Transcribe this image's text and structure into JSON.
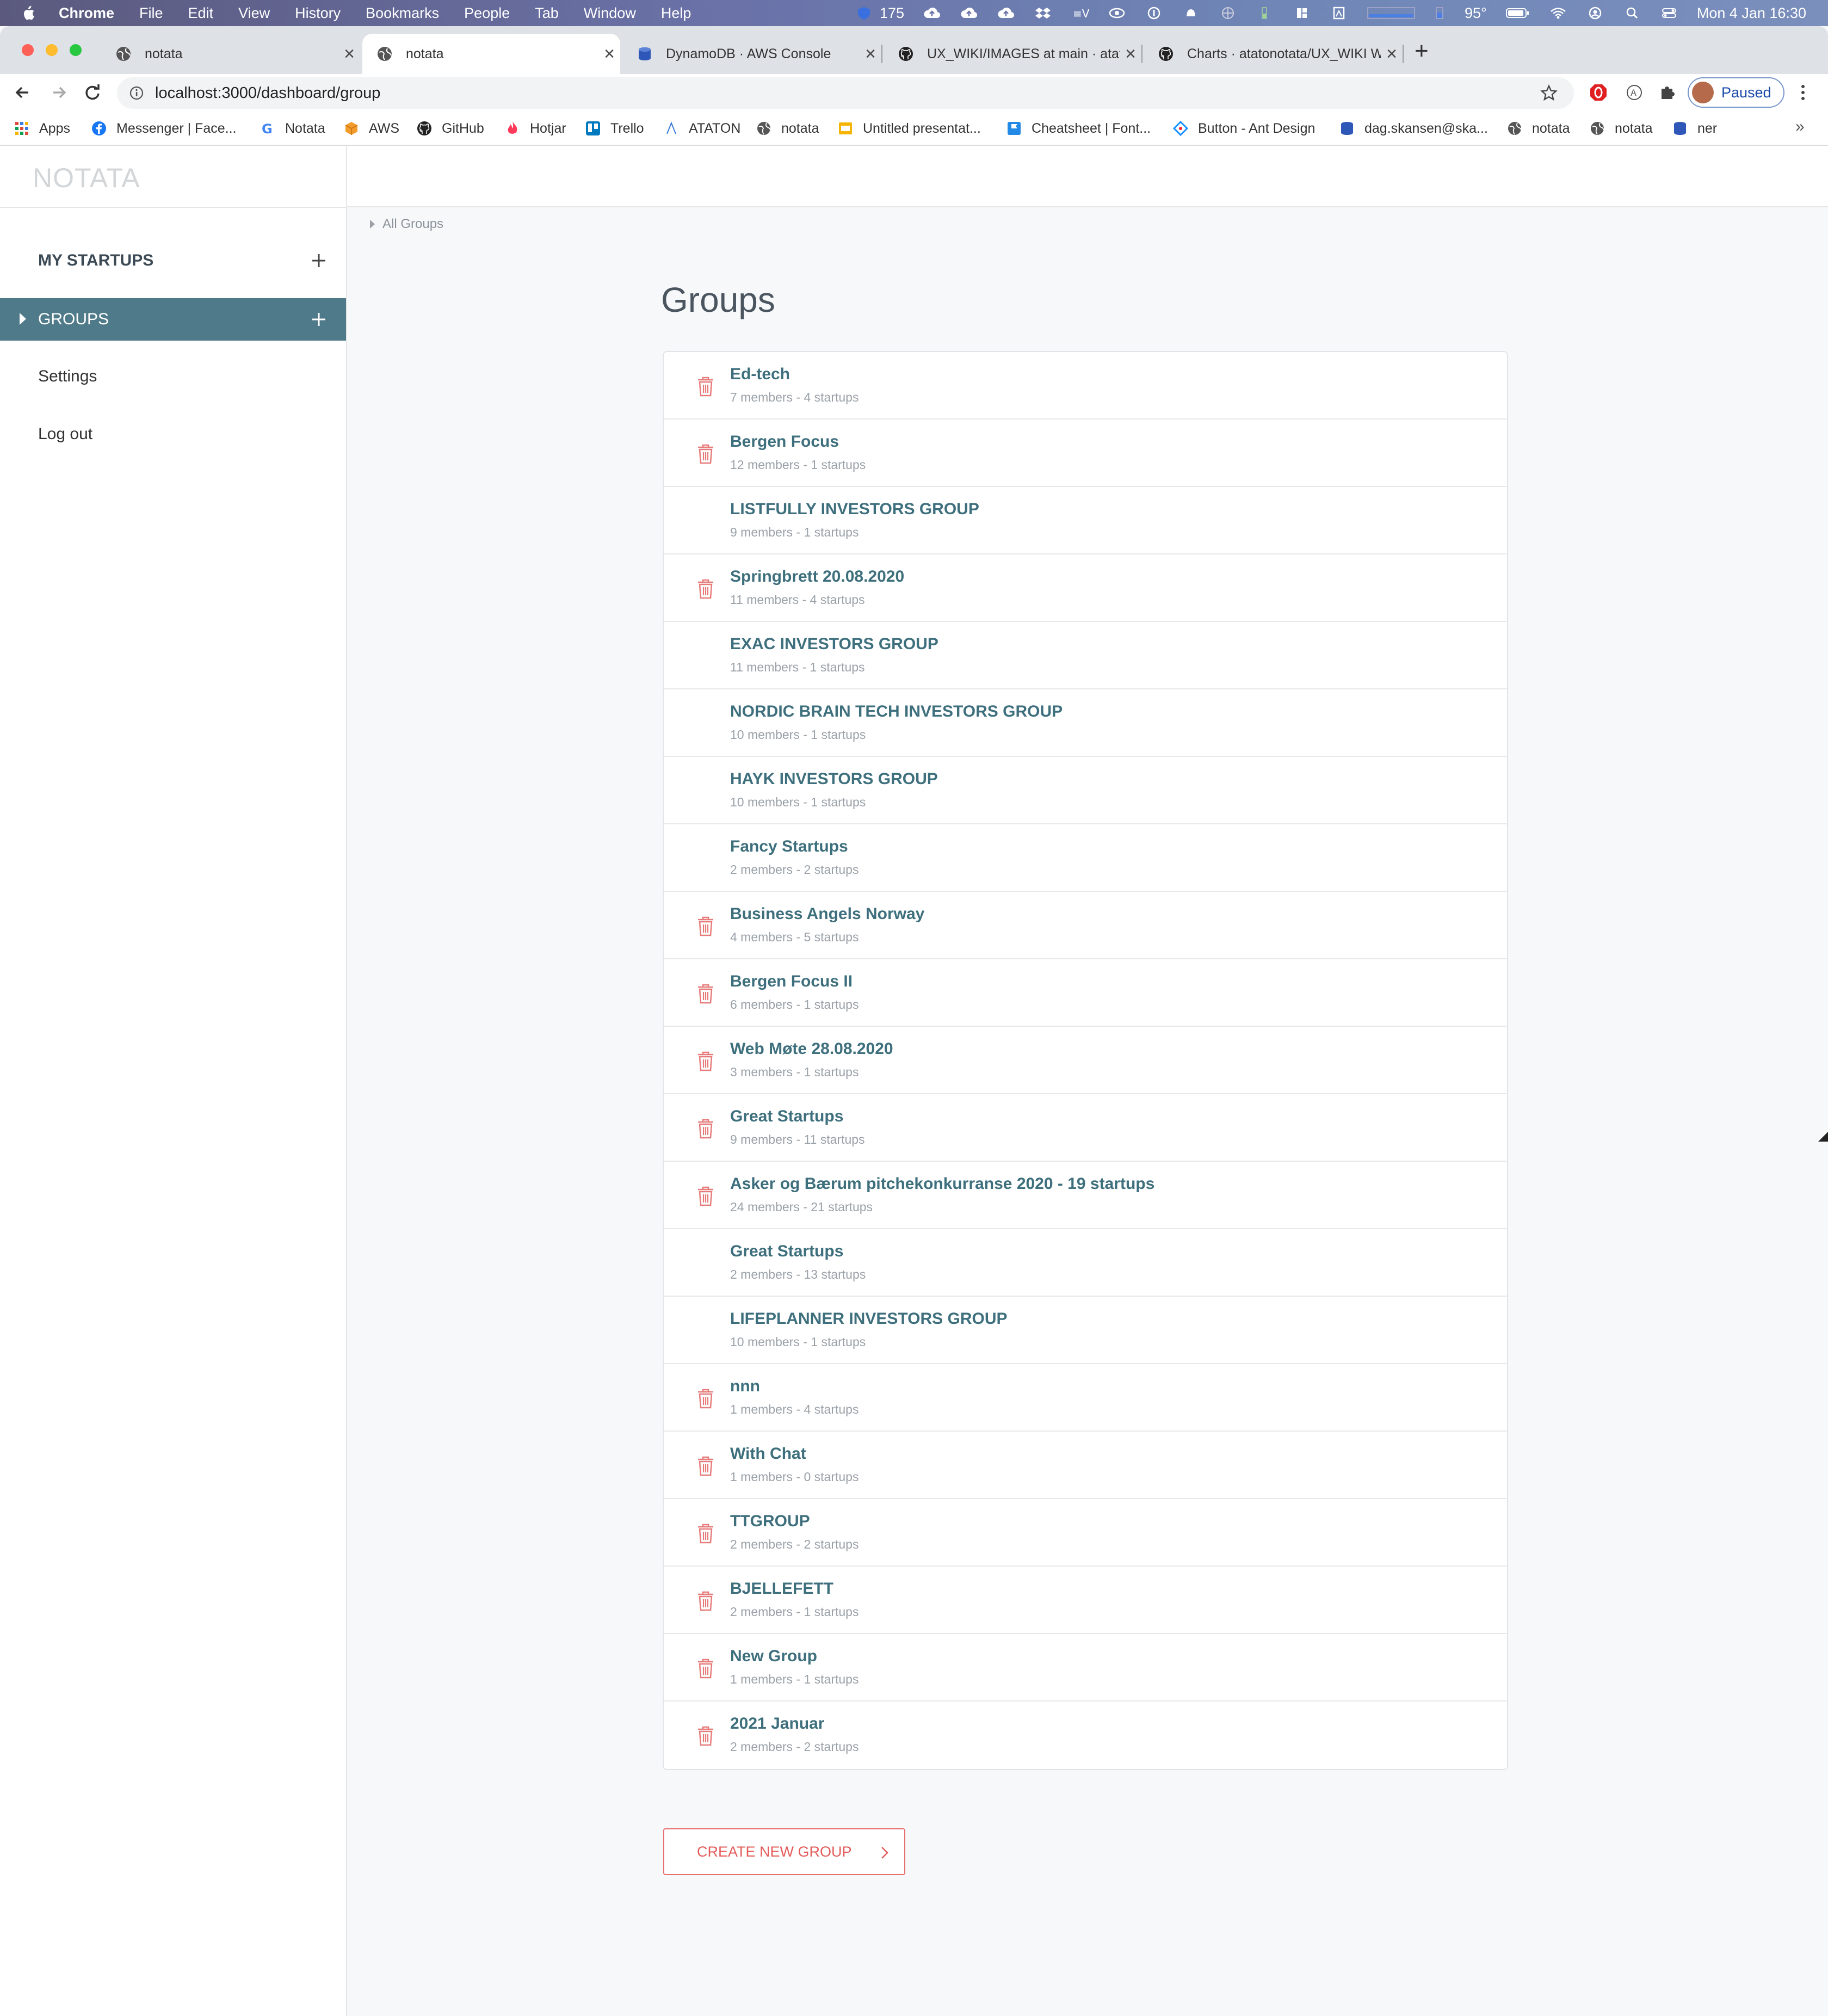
{
  "menubar": {
    "app": "Chrome",
    "items": [
      "File",
      "Edit",
      "View",
      "History",
      "Bookmarks",
      "People",
      "Tab",
      "Window",
      "Help"
    ],
    "badge_count": "175",
    "temperature": "95°",
    "clock": "Mon 4 Jan  16:30"
  },
  "tabs": [
    {
      "label": "notata",
      "icon": "globe-icon",
      "active": false
    },
    {
      "label": "notata",
      "icon": "globe-icon",
      "active": true
    },
    {
      "label": "DynamoDB · AWS Console",
      "icon": "dynamodb-icon",
      "active": false
    },
    {
      "label": "UX_WIKI/IMAGES at main · atat",
      "icon": "github-icon",
      "active": false
    },
    {
      "label": "Charts · atatonotata/UX_WIKI W",
      "icon": "github-icon",
      "active": false
    }
  ],
  "toolbar": {
    "url": "localhost:3000/dashboard/group",
    "profile_status": "Paused"
  },
  "bookmarks": [
    {
      "label": "Apps",
      "icon": "apps-grid-icon"
    },
    {
      "label": "Messenger | Face...",
      "icon": "facebook-icon"
    },
    {
      "label": "Notata",
      "icon": "google-icon"
    },
    {
      "label": "AWS",
      "icon": "aws-icon"
    },
    {
      "label": "GitHub",
      "icon": "github-icon"
    },
    {
      "label": "Hotjar",
      "icon": "hotjar-icon"
    },
    {
      "label": "Trello",
      "icon": "trello-icon"
    },
    {
      "label": "ATATON",
      "icon": "ataton-icon"
    },
    {
      "label": "notata",
      "icon": "globe-icon"
    },
    {
      "label": "Untitled presentat...",
      "icon": "slides-icon"
    },
    {
      "label": "Cheatsheet | Font...",
      "icon": "flag-icon"
    },
    {
      "label": "Button - Ant Design",
      "icon": "antdesign-icon"
    },
    {
      "label": "dag.skansen@ska...",
      "icon": "database-icon"
    },
    {
      "label": "notata",
      "icon": "globe-icon"
    },
    {
      "label": "notata",
      "icon": "globe-icon"
    },
    {
      "label": "ner",
      "icon": "database-icon"
    }
  ],
  "app": {
    "logo": "NOTATA",
    "sidebar": [
      {
        "label": "MY STARTUPS",
        "active": false
      },
      {
        "label": "GROUPS",
        "active": true
      },
      {
        "label": "Settings",
        "active": false
      },
      {
        "label": "Log out",
        "active": false
      }
    ],
    "breadcrumb": "All Groups",
    "title": "Groups",
    "groups": [
      {
        "name": "Ed-tech",
        "meta": "7 members - 4 startups",
        "deletable": true
      },
      {
        "name": "Bergen Focus",
        "meta": "12 members - 1 startups",
        "deletable": true
      },
      {
        "name": "LISTFULLY INVESTORS GROUP",
        "meta": "9 members - 1 startups",
        "deletable": false
      },
      {
        "name": "Springbrett 20.08.2020",
        "meta": "11 members - 4 startups",
        "deletable": true
      },
      {
        "name": "EXAC INVESTORS GROUP",
        "meta": "11 members - 1 startups",
        "deletable": false
      },
      {
        "name": "NORDIC BRAIN TECH INVESTORS GROUP",
        "meta": "10 members - 1 startups",
        "deletable": false
      },
      {
        "name": "HAYK INVESTORS GROUP",
        "meta": "10 members - 1 startups",
        "deletable": false
      },
      {
        "name": "Fancy Startups",
        "meta": "2 members - 2 startups",
        "deletable": false
      },
      {
        "name": "Business Angels Norway",
        "meta": "4 members - 5 startups",
        "deletable": true
      },
      {
        "name": "Bergen Focus II",
        "meta": "6 members - 1 startups",
        "deletable": true
      },
      {
        "name": "Web Møte 28.08.2020",
        "meta": "3 members - 1 startups",
        "deletable": true
      },
      {
        "name": "Great Startups",
        "meta": "9 members - 11 startups",
        "deletable": true
      },
      {
        "name": "Asker og Bærum pitchekonkurranse 2020 - 19 startups",
        "meta": "24 members - 21 startups",
        "deletable": true
      },
      {
        "name": "Great Startups",
        "meta": "2 members - 13 startups",
        "deletable": false
      },
      {
        "name": "LIFEPLANNER INVESTORS GROUP",
        "meta": "10 members - 1 startups",
        "deletable": false
      },
      {
        "name": "nnn",
        "meta": "1 members - 4 startups",
        "deletable": true
      },
      {
        "name": "With Chat",
        "meta": "1 members - 0 startups",
        "deletable": true
      },
      {
        "name": "TTGROUP",
        "meta": "2 members - 2 startups",
        "deletable": true
      },
      {
        "name": "BJELLEFETT",
        "meta": "2 members - 1 startups",
        "deletable": true
      },
      {
        "name": "New Group",
        "meta": "1 members - 1 startups",
        "deletable": true
      },
      {
        "name": "2021 Januar",
        "meta": "2 members - 2 startups",
        "deletable": true
      }
    ],
    "create_button": "CREATE NEW GROUP"
  },
  "colors": {
    "accent_teal": "#4f7a8a",
    "group_name": "#3e6f7d",
    "delete_red": "#e25b5a"
  }
}
